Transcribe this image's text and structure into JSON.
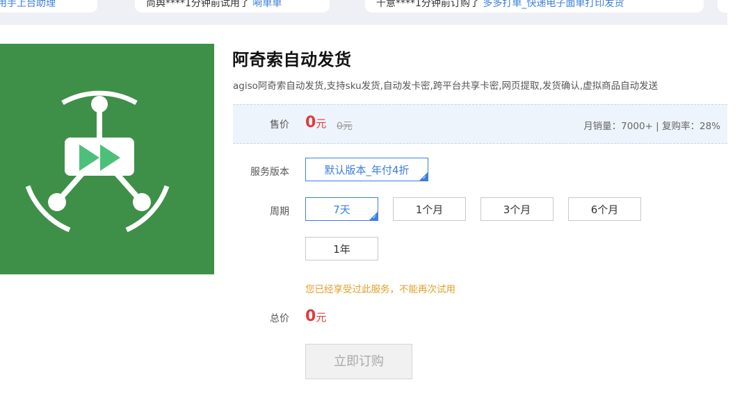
{
  "ticker": [
    {
      "who": "",
      "action": "",
      "product": "用手上台助理"
    },
    {
      "who": "尚舆****",
      "action": "1分钟前试用了",
      "product": "嗬单单"
    },
    {
      "who": "千意****",
      "action": "1分钟前订购了",
      "product": "多多打单_快递电子面单打印发货"
    }
  ],
  "product": {
    "icon": "robot-play-logo",
    "title": "阿奇索自动发货",
    "description": "agiso阿奇索自动发货,支持sku发货,自动发卡密,跨平台共享卡密,网页提取,发货确认,虚拟商品自动发送"
  },
  "price": {
    "label": "售价",
    "current": "0",
    "unit": "元",
    "original": "0元",
    "stats": "月销量：7000+ | 复购率：28%"
  },
  "version": {
    "label": "服务版本",
    "selected": "默认版本_年付4折"
  },
  "period": {
    "label": "周期",
    "options": [
      "7天",
      "1个月",
      "3个月",
      "6个月",
      "1年"
    ],
    "selected_index": 0
  },
  "notice": "您已经享受过此服务，不能再次试用",
  "total": {
    "label": "总价",
    "value": "0",
    "unit": "元"
  },
  "buy_button": "立即订购",
  "colors": {
    "accent": "#3b7de0",
    "price": "#e23b3b",
    "notice": "#e0a02a",
    "logo_bg": "#3e9048",
    "play": "#4cc07a"
  }
}
